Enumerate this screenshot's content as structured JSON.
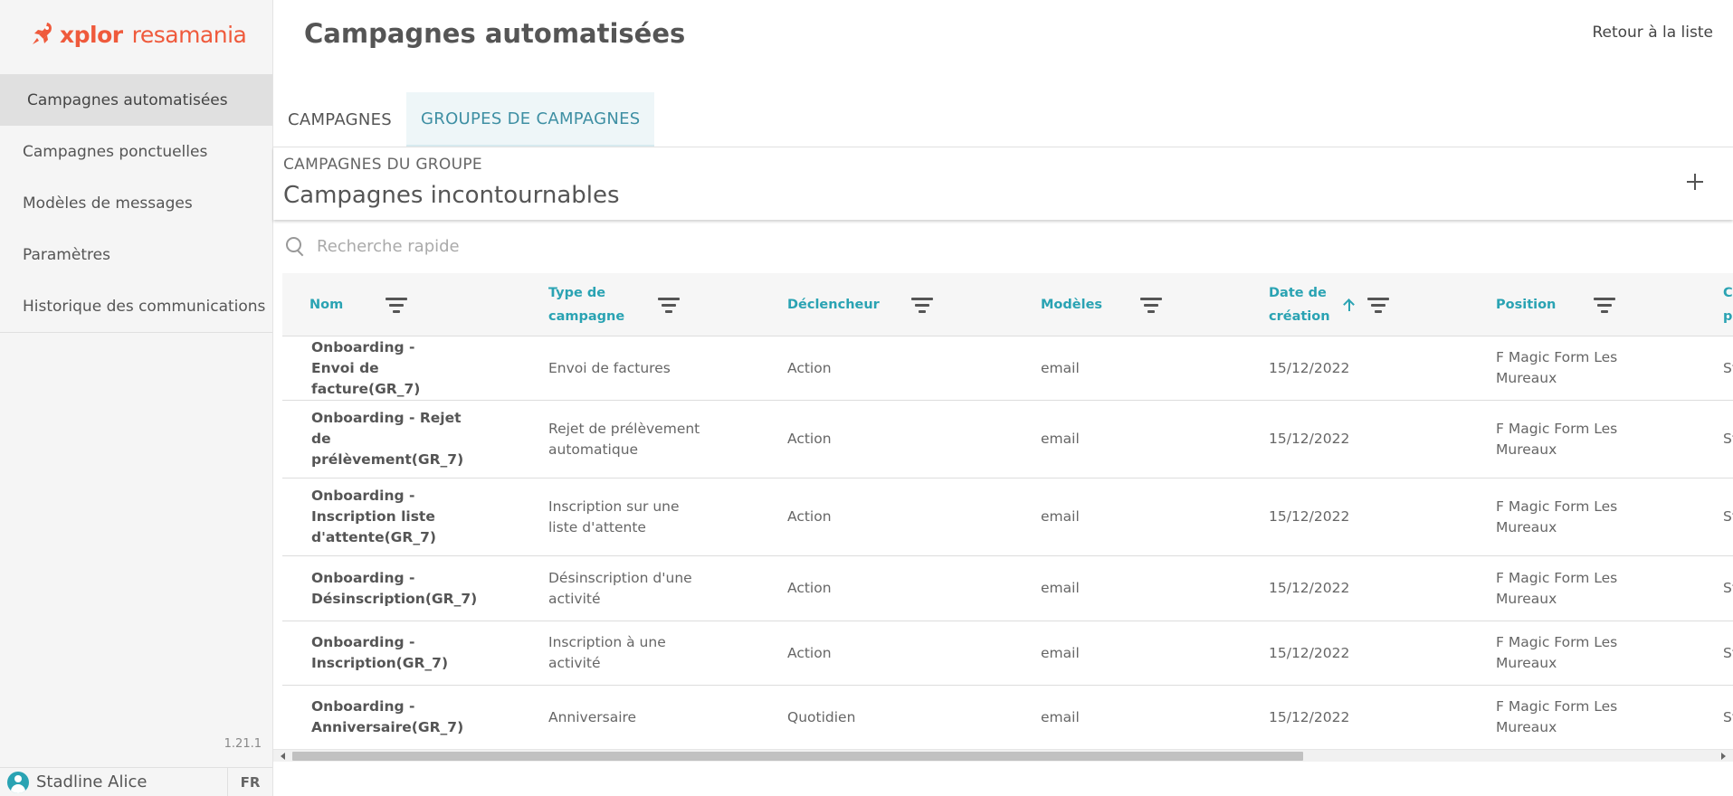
{
  "brand": {
    "part1": "xplor",
    "part2": "resamania",
    "color": "#ef5a3c"
  },
  "sidebar": {
    "items": [
      {
        "label": "Campagnes automatisées",
        "active": true
      },
      {
        "label": "Campagnes ponctuelles",
        "active": false
      },
      {
        "label": "Modèles de messages",
        "active": false
      },
      {
        "label": "Paramètres",
        "active": false
      },
      {
        "label": "Historique des communications",
        "active": false
      }
    ],
    "version": "1.21.1",
    "user": {
      "name": "Stadline Alice",
      "icon": "user-avatar-icon"
    },
    "lang": "FR"
  },
  "header": {
    "title": "Campagnes automatisées",
    "back_label": "Retour à la liste"
  },
  "tabs": [
    {
      "label": "CAMPAGNES",
      "active": false
    },
    {
      "label": "GROUPES DE CAMPAGNES",
      "active": true
    }
  ],
  "group": {
    "subtitle": "CAMPAGNES DU GROUPE",
    "name": "Campagnes incontournables"
  },
  "search": {
    "placeholder": "Recherche rapide",
    "value": ""
  },
  "table": {
    "columns": [
      {
        "label": "Nom",
        "sorted": false
      },
      {
        "label": "Type de campagne",
        "sorted": false
      },
      {
        "label": "Déclencheur",
        "sorted": false
      },
      {
        "label": "Modèles",
        "sorted": false
      },
      {
        "label": "Date de création",
        "sorted": "asc"
      },
      {
        "label": "Position",
        "sorted": false
      },
      {
        "label": "Cr pa",
        "sorted": false
      }
    ],
    "rows": [
      {
        "nom": "Onboarding - Envoi de facture(GR_7)",
        "type": "Envoi de factures",
        "declencheur": "Action",
        "modeles": "email",
        "date": "15/12/2022",
        "position": "F Magic Form Les Mureaux",
        "cree_par": "St"
      },
      {
        "nom": "Onboarding - Rejet de prélèvement(GR_7)",
        "type": "Rejet de prélèvement automatique",
        "declencheur": "Action",
        "modeles": "email",
        "date": "15/12/2022",
        "position": "F Magic Form Les Mureaux",
        "cree_par": "St"
      },
      {
        "nom": "Onboarding - Inscription liste d'attente(GR_7)",
        "type": "Inscription sur une liste d'attente",
        "declencheur": "Action",
        "modeles": "email",
        "date": "15/12/2022",
        "position": "F Magic Form Les Mureaux",
        "cree_par": "St"
      },
      {
        "nom": "Onboarding - Désinscription(GR_7)",
        "type": "Désinscription d'une activité",
        "declencheur": "Action",
        "modeles": "email",
        "date": "15/12/2022",
        "position": "F Magic Form Les Mureaux",
        "cree_par": "St"
      },
      {
        "nom": "Onboarding - Inscription(GR_7)",
        "type": "Inscription à une activité",
        "declencheur": "Action",
        "modeles": "email",
        "date": "15/12/2022",
        "position": "F Magic Form Les Mureaux",
        "cree_par": "St"
      },
      {
        "nom": "Onboarding - Anniversaire(GR_7)",
        "type": "Anniversaire",
        "declencheur": "Quotidien",
        "modeles": "email",
        "date": "15/12/2022",
        "position": "F Magic Form Les Mureaux",
        "cree_par": "St"
      }
    ]
  },
  "colors": {
    "accent": "#2aa3b3",
    "tab_active_text": "#3e8fa3",
    "tab_active_bg": "#eef6f8"
  }
}
